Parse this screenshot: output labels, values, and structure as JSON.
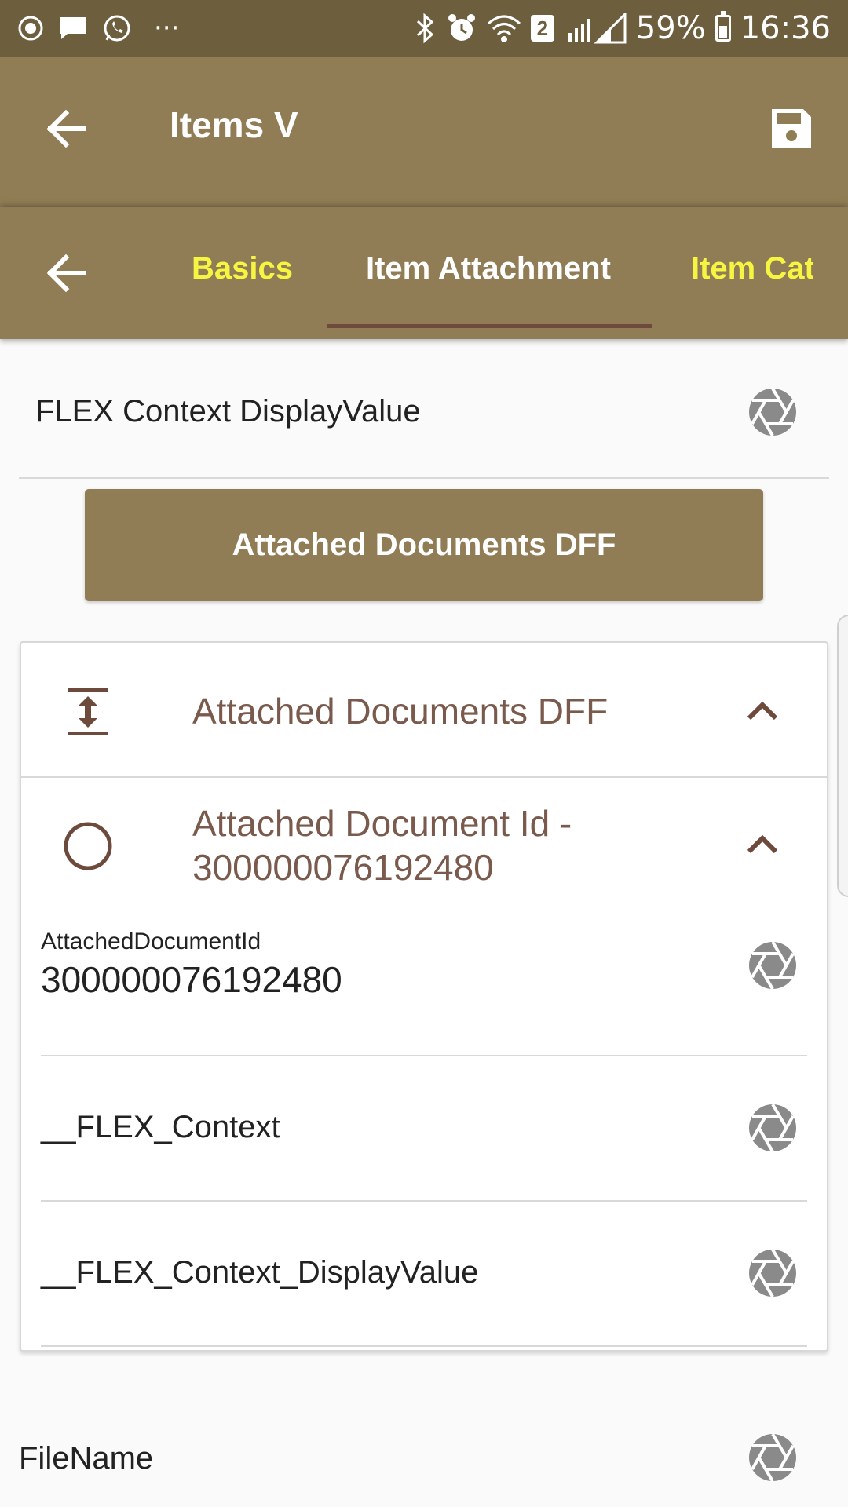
{
  "status_bar": {
    "left_icons": [
      "play-circle-icon",
      "chat-bubble-icon",
      "whatsapp-icon",
      "more-dots-icon"
    ],
    "more_dots": "···",
    "right_icons": [
      "bluetooth-icon",
      "alarm-icon",
      "wifi-icon",
      "signal-icon",
      "battery-icon"
    ],
    "sim_badge": "2",
    "battery": "59%",
    "time": "16:36"
  },
  "app_bar": {
    "title": "Items V",
    "back_icon": "arrow-back-icon",
    "save_icon": "save-icon"
  },
  "tabs": {
    "back_icon": "arrow-back-icon",
    "items": [
      {
        "label": "Basics",
        "active": false
      },
      {
        "label": "Item Attachment",
        "active": true
      },
      {
        "label": "Item Cat",
        "active": false
      }
    ]
  },
  "flex_context": {
    "label": "FLEX Context DisplayValue",
    "icon": "aperture-icon"
  },
  "dff_button": {
    "label": "Attached Documents DFF"
  },
  "card": {
    "header": {
      "title": "Attached Documents DFF",
      "icon": "expand-vertical-icon",
      "chevron": "chevron-up-icon"
    },
    "sub_header": {
      "title": "Attached Document Id - 300000076192480",
      "icon": "radio-circle-icon",
      "chevron": "chevron-up-icon"
    },
    "fields": [
      {
        "small_label": "AttachedDocumentId",
        "value": "300000076192480"
      },
      {
        "label": "__FLEX_Context"
      },
      {
        "label": "__FLEX_Context_DisplayValue"
      }
    ]
  },
  "filename": {
    "label": "FileName"
  },
  "colors": {
    "app_bar": "#917d55",
    "status_bar": "#6d5e3e",
    "active_tab": "#ffffff",
    "inactive_tab": "#f5f542",
    "tab_indicator": "#6e4a3d",
    "card_title": "#7a5a4c",
    "icon_gray": "#8a8a8a"
  }
}
